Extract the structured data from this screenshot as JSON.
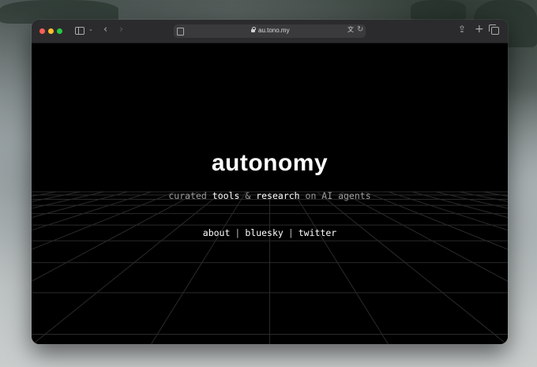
{
  "browser": {
    "url": "au.tono.my",
    "icons": [
      "sidebar-icon",
      "chevron-down-icon",
      "back-icon",
      "forward-icon",
      "reader-icon",
      "lock-icon",
      "translate-icon",
      "reload-icon",
      "share-icon",
      "plus-icon",
      "tabs-icon"
    ]
  },
  "page": {
    "title": "autonomy",
    "tagline": {
      "part1": "curated",
      "highlight1": "tools",
      "part2": "&",
      "highlight2": "research",
      "part3": "on AI agents"
    },
    "links": [
      {
        "label": "about"
      },
      {
        "label": "bluesky"
      },
      {
        "label": "twitter"
      }
    ],
    "separator": "|"
  },
  "colors": {
    "background": "#000000",
    "text_primary": "#ffffff",
    "text_muted": "#9a9a9a",
    "grid_line": "#2a2a2a"
  }
}
